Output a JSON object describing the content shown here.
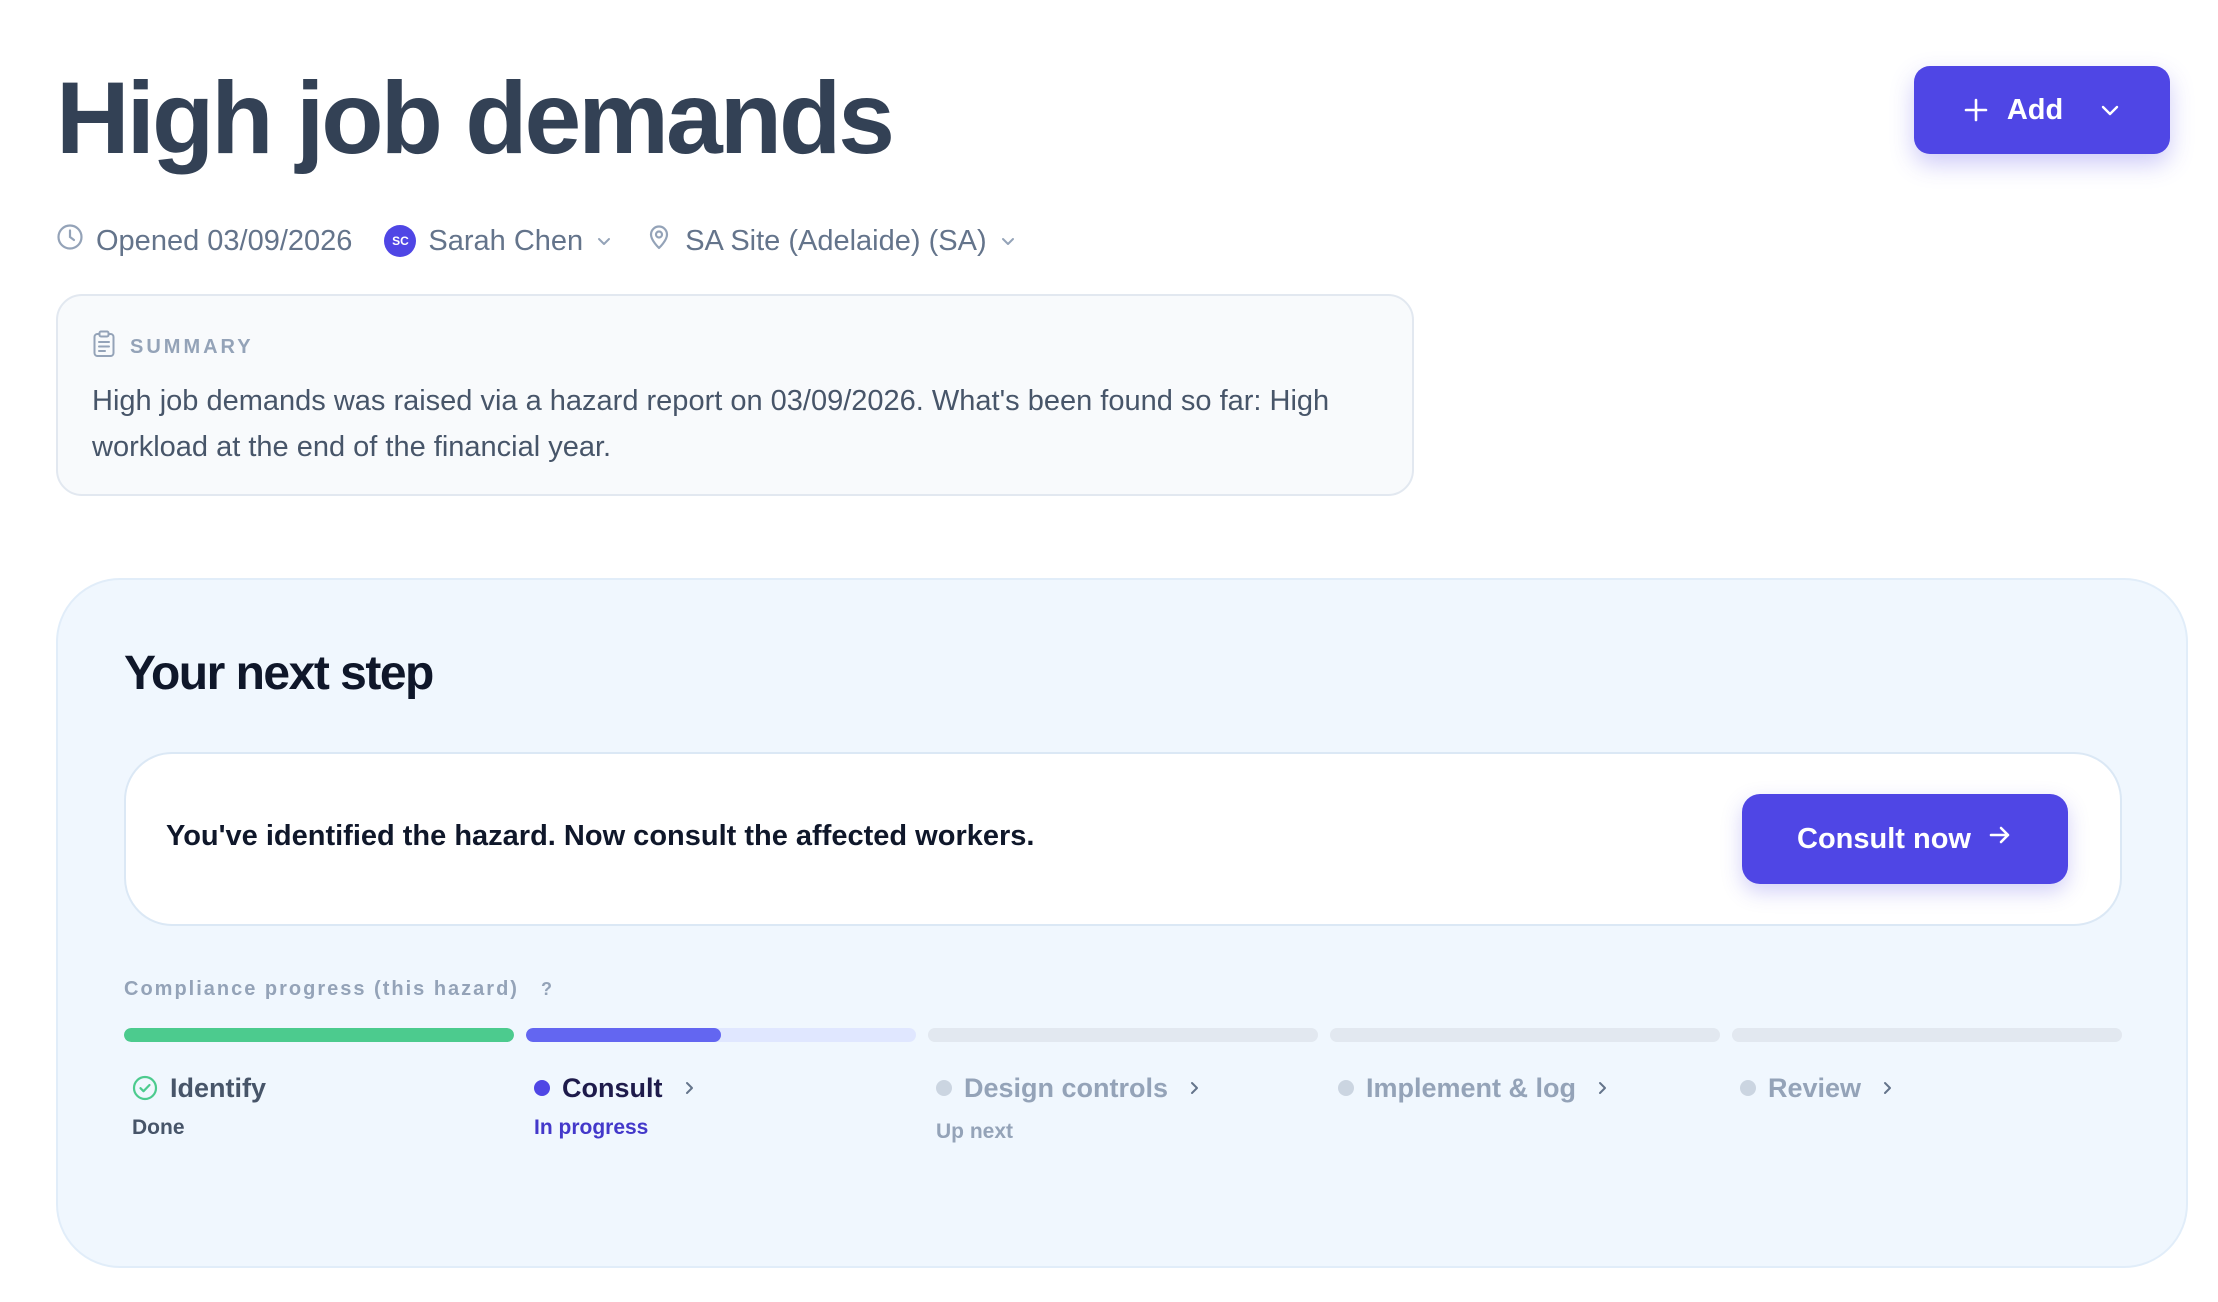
{
  "header": {
    "title": "High job demands",
    "add_label": "Add"
  },
  "meta": {
    "opened": "Opened 03/09/2026",
    "assignee_initials": "SC",
    "assignee_name": "Sarah Chen",
    "site": "SA Site (Adelaide) (SA)"
  },
  "summary": {
    "heading": "SUMMARY",
    "text": "High job demands was raised via a hazard report on 03/09/2026. What's been found so far: High workload at the end of the financial year."
  },
  "next_step": {
    "title": "Your next step",
    "message": "You've identified the hazard. Now consult the affected workers.",
    "action_label": "Consult now"
  },
  "progress": {
    "label": "Compliance progress (this hazard)",
    "help": "?",
    "steps": [
      {
        "label": "Identify",
        "status": "Done",
        "state": "done",
        "fill": 1.0
      },
      {
        "label": "Consult",
        "status": "In progress",
        "state": "in-progress",
        "fill": 0.5
      },
      {
        "label": "Design controls",
        "status": "Up next",
        "state": "up-next",
        "fill": 0
      },
      {
        "label": "Implement & log",
        "status": "",
        "state": "pending",
        "fill": 0
      },
      {
        "label": "Review",
        "status": "",
        "state": "pending",
        "fill": 0
      }
    ]
  },
  "colors": {
    "accent": "#4f46e5",
    "done": "#4ccb8e",
    "in_progress_fill": "#6366f1",
    "in_progress_track": "#e0e7ff",
    "pending": "#e2e8f0",
    "done_text": "#475569",
    "in_progress_text": "#4338ca",
    "muted_text": "#94a3b8"
  },
  "icons": {
    "add": "plus-icon",
    "add_menu": "chevron-down-icon",
    "opened": "clock-icon",
    "site": "map-pin-icon",
    "summary": "clipboard-icon",
    "consult": "arrow-right-icon",
    "done_step": "check-circle-icon",
    "step_chevron": "chevron-right-icon"
  }
}
